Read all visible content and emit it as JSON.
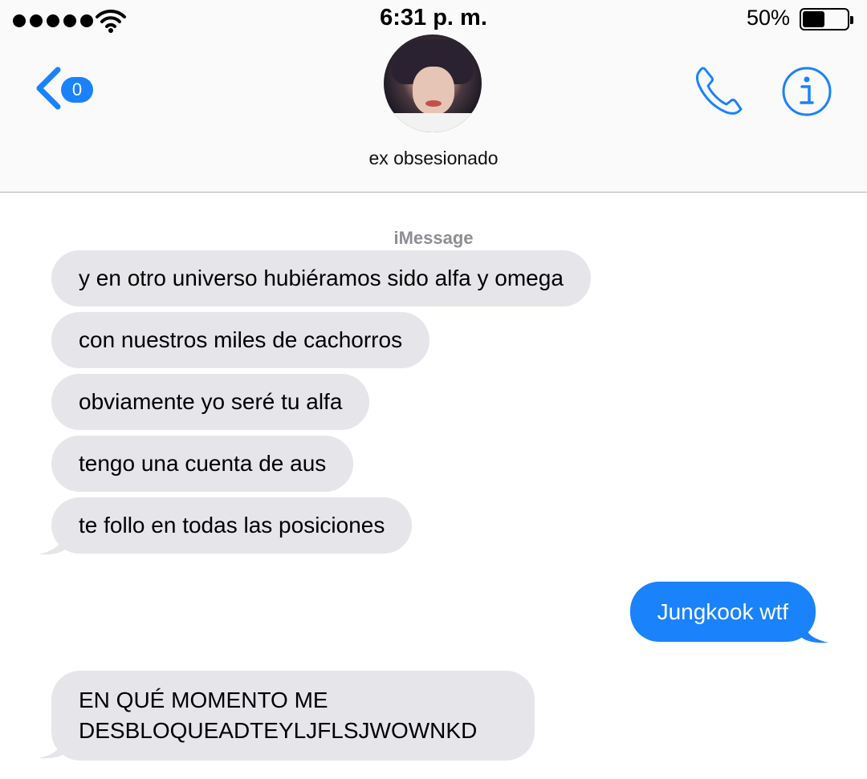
{
  "status_bar": {
    "time": "6:31 p. m.",
    "battery_percent": "50%",
    "battery_level": 0.5,
    "signal_bars": 5,
    "signal_icon": "signal-dots-icon",
    "wifi_icon": "wifi-icon",
    "battery_icon": "battery-icon"
  },
  "header": {
    "back_icon": "chevron-left-icon",
    "unread_count": "0",
    "contact_name": "ex obsesionado",
    "call_icon": "phone-icon",
    "info_icon": "info-icon"
  },
  "conversation": {
    "service_label": "iMessage",
    "messages": [
      {
        "sender": "them",
        "text": "y en otro universo hubiéramos sido alfa y omega"
      },
      {
        "sender": "them",
        "text": "con nuestros miles de cachorros"
      },
      {
        "sender": "them",
        "text": "obviamente yo seré tu alfa"
      },
      {
        "sender": "them",
        "text": "tengo una cuenta de aus"
      },
      {
        "sender": "them",
        "text": "te follo en todas las posiciones"
      },
      {
        "sender": "me",
        "text": "Jungkook wtf"
      },
      {
        "sender": "them",
        "text": "EN QUÉ MOMENTO ME DESBLOQUEADTEYLJFLSJWOWNKD"
      }
    ]
  },
  "colors": {
    "accent": "#1a82fb",
    "incoming_bubble": "#e5e5ea",
    "outgoing_bubble": "#1a82fb",
    "header_background": "#fafafa",
    "service_label": "#8e8e93"
  }
}
